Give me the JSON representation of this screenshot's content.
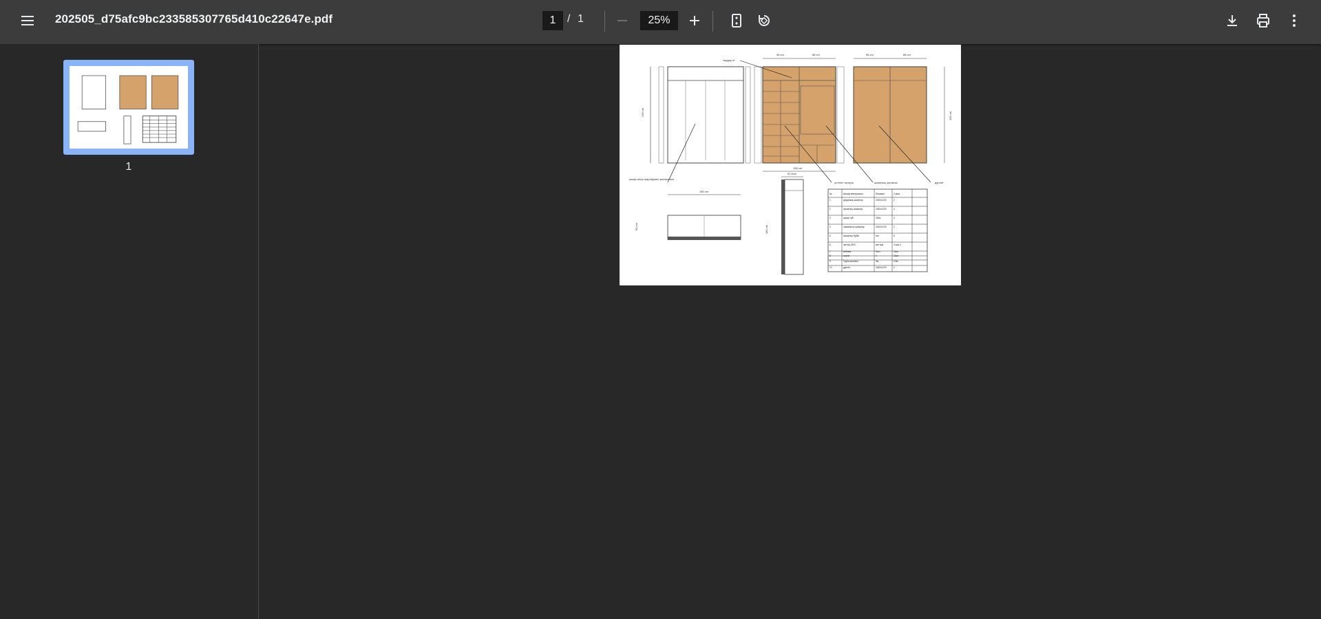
{
  "toolbar": {
    "menu_icon": "hamburger-menu-icon",
    "title": "202505_d75afc9bc233585307765d410c22647e.pdf",
    "page_current": "1",
    "page_separator": "/",
    "page_total": "1",
    "zoom_value": "25%",
    "zoom_out_icon": "minus-icon",
    "zoom_in_icon": "plus-icon",
    "fit_icon": "fit-page-icon",
    "rotate_icon": "rotate-icon",
    "download_icon": "download-icon",
    "print_icon": "print-icon",
    "more_icon": "more-vertical-icon"
  },
  "sidebar": {
    "thumbnails": [
      {
        "label": "1",
        "selected": true
      }
    ]
  },
  "document": {
    "dimension_labels": [
      "96 cm",
      "88 cm",
      "96 cm",
      "88 cm",
      "236 cm",
      "196 cm",
      "196 cm",
      "170 cm",
      "76 cm",
      "180 cm",
      "61,5cm",
      "180 cm",
      "60 cm",
      "2 cm",
      "2 cm",
      "2 cm"
    ],
    "callouts": [
      "таңдау ге",
      "шкаф ағаш шарнирмен жиналатын",
      "үстелігі тіреуіш",
      "шкафтың желкеші",
      "дуплет"
    ],
    "table_headers": [
      "№",
      "Шкаф материалы",
      "Өлшемі",
      "Саны"
    ],
    "table_rows": [
      [
        "1",
        "қаңқа/жақ шкафтар",
        "2440х1220",
        "2"
      ],
      [
        "2",
        "шкафтың шкафтар",
        "2440х1220",
        "4"
      ],
      [
        "3",
        "шкаф түбі",
        "20см",
        "4"
      ],
      [
        "4",
        "ламинатлы шкафтар",
        "2440х1220",
        "2"
      ],
      [
        "5",
        "шкафтың бүйірі",
        "есс",
        "8"
      ],
      [
        "6",
        "заттар-1500",
        "көп жақ",
        "3 жақ 4"
      ],
      [
        "7",
        "кебекке",
        "болт",
        "24шт"
      ],
      [
        "8",
        "сырғы",
        "4",
        "12шт"
      ],
      [
        "9",
        "Труба желкеші",
        "3м",
        "0,8м"
      ],
      [
        "10",
        "дуплет",
        "2440х1220",
        "2"
      ]
    ]
  },
  "colors": {
    "toolbar_bg": "#3c3c3c",
    "viewer_bg": "#282828",
    "thumb_selected": "#8ab4f8",
    "wood": "#d4a26a"
  }
}
